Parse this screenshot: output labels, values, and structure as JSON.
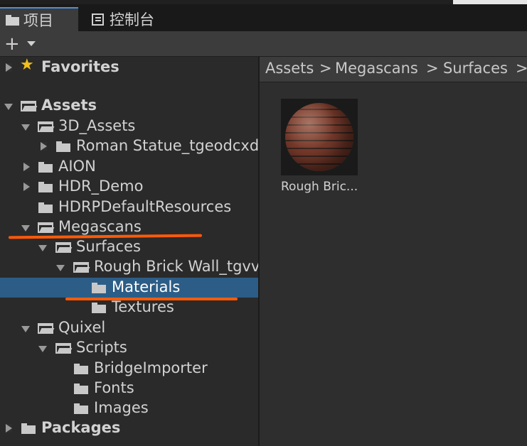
{
  "tabs": {
    "project_label": "项目",
    "console_label": "控制台"
  },
  "toolbar": {
    "add_label": "+"
  },
  "tree": {
    "favorites": "Favorites",
    "assets": "Assets",
    "assets_3d": "3D_Assets",
    "roman_statue": "Roman Statue_tgeodcxd",
    "aion": "AION",
    "hdr_demo": "HDR_Demo",
    "hdrp_default": "HDRPDefaultResources",
    "megascans": "Megascans",
    "surfaces": "Surfaces",
    "rough_brick_wall": "Rough Brick Wall_tgvv",
    "materials": "Materials",
    "textures": "Textures",
    "quixel": "Quixel",
    "scripts": "Scripts",
    "bridge_importer": "BridgeImporter",
    "fonts": "Fonts",
    "images": "Images",
    "packages": "Packages"
  },
  "breadcrumb": {
    "items": [
      "Assets",
      "Megascans",
      "Surfaces"
    ],
    "separator": ">"
  },
  "content": {
    "asset_label": "Rough Bric..."
  },
  "colors": {
    "selection": "#2c5d87",
    "annotation": "#ff5a0a",
    "star": "#f2c01e"
  }
}
